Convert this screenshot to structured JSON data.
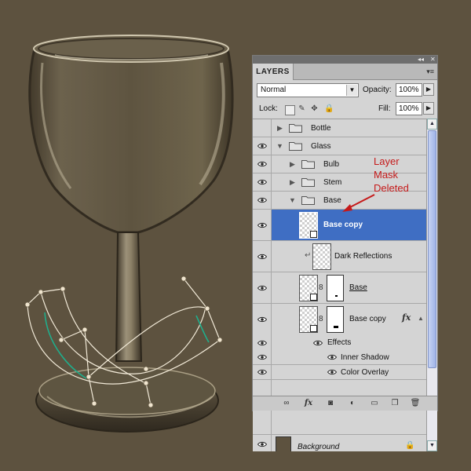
{
  "panel": {
    "tab_title": "LAYERS",
    "collapse_glyph": "◂◂",
    "close_glyph": "✕",
    "menu_glyph": "▾≡",
    "blend_mode": "Normal",
    "opacity_label": "Opacity:",
    "opacity_value": "100%",
    "lock_label": "Lock:",
    "fill_label": "Fill:",
    "fill_value": "100%",
    "flyout_glyph": "▶"
  },
  "layers": [
    {
      "id": "bottle",
      "name": "Bottle",
      "type": "group",
      "visible": false,
      "expanded": false
    },
    {
      "id": "glass",
      "name": "Glass",
      "type": "group",
      "visible": true,
      "expanded": true
    },
    {
      "id": "bulb",
      "name": "Bulb",
      "type": "group",
      "visible": true,
      "expanded": false
    },
    {
      "id": "stem",
      "name": "Stem",
      "type": "group",
      "visible": true,
      "expanded": false
    },
    {
      "id": "base",
      "name": "Base",
      "type": "group",
      "visible": true,
      "expanded": true
    },
    {
      "id": "base-copy-selected",
      "name": "Base copy",
      "type": "layer",
      "visible": true,
      "selected": true
    },
    {
      "id": "dark-reflections",
      "name": "Dark Reflections",
      "type": "layer",
      "visible": true,
      "clipped": true
    },
    {
      "id": "base-layer",
      "name": "Base",
      "type": "layer",
      "visible": true,
      "has_mask": true
    },
    {
      "id": "base-copy-fx",
      "name": "Base copy",
      "type": "layer",
      "visible": true,
      "has_mask": true,
      "fx": "fx"
    },
    {
      "id": "effects",
      "name": "Effects",
      "type": "effects-header",
      "visible": true
    },
    {
      "id": "inner-shadow",
      "name": "Inner Shadow",
      "type": "effect",
      "visible": true
    },
    {
      "id": "color-overlay",
      "name": "Color Overlay",
      "type": "effect",
      "visible": true
    },
    {
      "id": "background",
      "name": "Background",
      "type": "background",
      "visible": true,
      "locked": true
    }
  ],
  "annotation": {
    "lines": [
      "Layer",
      "Mask",
      "Deleted"
    ],
    "color": "#c51a1a"
  },
  "bottom_icons": [
    "link-icon",
    "fx-icon",
    "mask-icon",
    "adjustment-icon",
    "folder-icon",
    "new-layer-icon",
    "trash-icon"
  ],
  "colors": {
    "background": "#5d523f",
    "selection": "#3f6ec3",
    "panel": "#d4d4d4"
  }
}
